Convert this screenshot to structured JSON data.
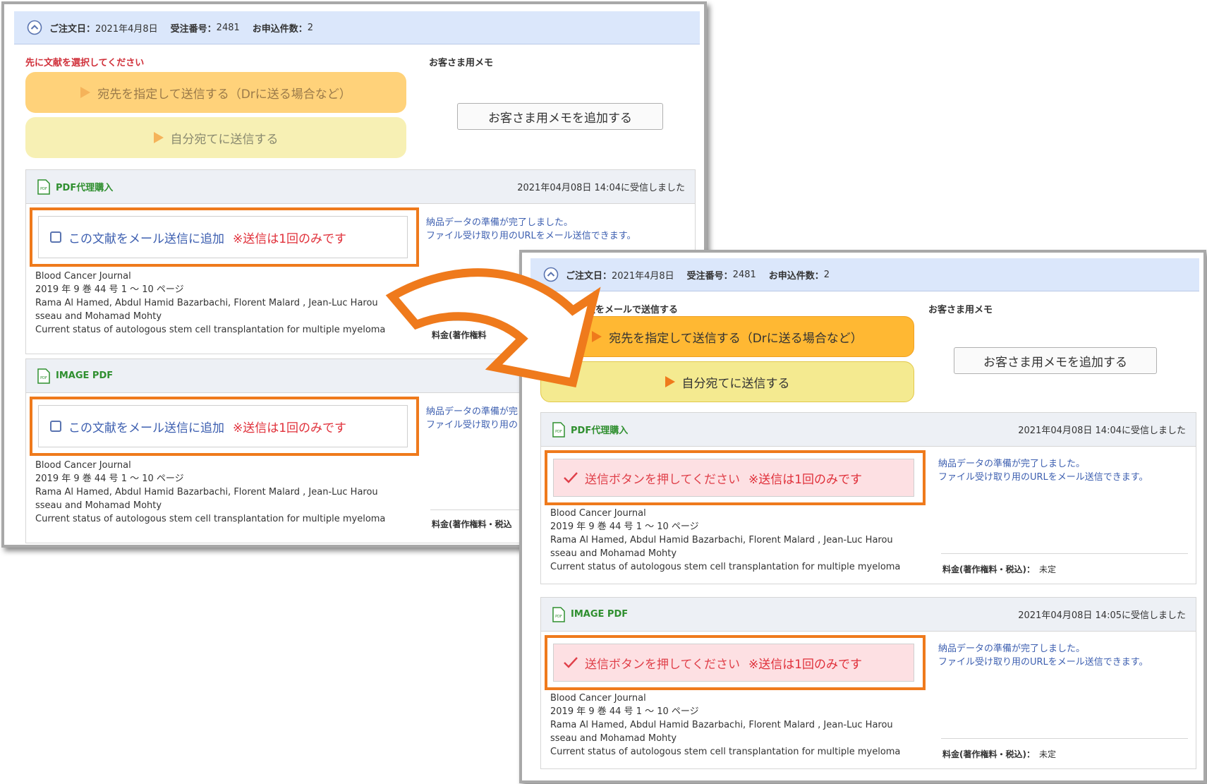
{
  "colors": {
    "accent_orange": "#ef7a1c",
    "header_blue": "#dbe7fb",
    "link_blue": "#3d5fb0",
    "warn_red": "#e0303a",
    "product_green": "#2f8f2f",
    "check_bg": "#fde0e3",
    "btn_orange": "#ffb833",
    "btn_yellow": "#f4ea90"
  },
  "before": {
    "order": {
      "date_label": "ご注文日：",
      "date": "2021年4月8日",
      "number_label": "受注番号：",
      "number": "2481",
      "count_label": "お申込件数：",
      "count": "2"
    },
    "instruction": "先に文献を選択してください",
    "memo_label": "お客さま用メモ",
    "send_to_button": "宛先を指定して送信する（Drに送る場合など）",
    "send_self_button": "自分宛てに送信する",
    "memo_button": "お客さま用メモを追加する",
    "items": [
      {
        "type": "PDF代理購入",
        "received": "2021年04月08日 14:04に受信しました",
        "check_label": "この文献をメール送信に追加",
        "note": "※送信は1回のみです",
        "ready_1": "納品データの準備が完了しました。",
        "ready_2": "ファイル受け取り用のURLをメール送信できます。",
        "journal": "Blood Cancer Journal",
        "issue": "2019 年 9 巻 44 号 1 ～ 10 ページ",
        "authors_1": "Rama Al Hamed, Abdul Hamid Bazarbachi, Florent Malard , Jean-Luc Harou",
        "authors_2": "sseau and Mohamad Mohty",
        "title": "Current status of autologous stem cell transplantation for multiple myeloma",
        "price_label": "料金(著作権料"
      },
      {
        "type": "IMAGE PDF",
        "check_label": "この文献をメール送信に追加",
        "note": "※送信は1回のみです",
        "ready_1": "納品データの準備が完",
        "ready_2": "ファイル受け取り用の",
        "journal": "Blood Cancer Journal",
        "issue": "2019 年 9 巻 44 号 1 ～ 10 ページ",
        "authors_1": "Rama Al Hamed, Abdul Hamid Bazarbachi, Florent Malard , Jean-Luc Harou",
        "authors_2": "sseau and Mohamad Mohty",
        "title": "Current status of autologous stem cell transplantation for multiple myeloma",
        "price_label": "料金(著作権料・税込"
      }
    ]
  },
  "after": {
    "order": {
      "date_label": "ご注文日：",
      "date": "2021年4月8日",
      "number_label": "受注番号：",
      "number": "2481",
      "count_label": "お申込件数：",
      "count": "2"
    },
    "instruction": "選択した文献をメールで送信する",
    "memo_label": "お客さま用メモ",
    "send_to_button": "宛先を指定して送信する（Drに送る場合など）",
    "send_self_button": "自分宛てに送信する",
    "memo_button": "お客さま用メモを追加する",
    "items": [
      {
        "type": "PDF代理購入",
        "received": "2021年04月08日 14:04に受信しました",
        "check_label": "送信ボタンを押してください",
        "note": "※送信は1回のみです",
        "ready_1": "納品データの準備が完了しました。",
        "ready_2": "ファイル受け取り用のURLをメール送信できます。",
        "journal": "Blood Cancer Journal",
        "issue": "2019 年 9 巻 44 号 1 ～ 10 ページ",
        "authors_1": "Rama Al Hamed, Abdul Hamid Bazarbachi, Florent Malard , Jean-Luc Harou",
        "authors_2": "sseau and Mohamad Mohty",
        "title": "Current status of autologous stem cell transplantation for multiple myeloma",
        "price_label": "料金(著作権料・税込)：",
        "price": "未定"
      },
      {
        "type": "IMAGE PDF",
        "received": "2021年04月08日 14:05に受信しました",
        "check_label": "送信ボタンを押してください",
        "note": "※送信は1回のみです",
        "ready_1": "納品データの準備が完了しました。",
        "ready_2": "ファイル受け取り用のURLをメール送信できます。",
        "journal": "Blood Cancer Journal",
        "issue": "2019 年 9 巻 44 号 1 ～ 10 ページ",
        "authors_1": "Rama Al Hamed, Abdul Hamid Bazarbachi, Florent Malard , Jean-Luc Harou",
        "authors_2": "sseau and Mohamad Mohty",
        "title": "Current status of autologous stem cell transplantation for multiple myeloma",
        "price_label": "料金(著作権料・税込)：",
        "price": "未定"
      }
    ]
  }
}
